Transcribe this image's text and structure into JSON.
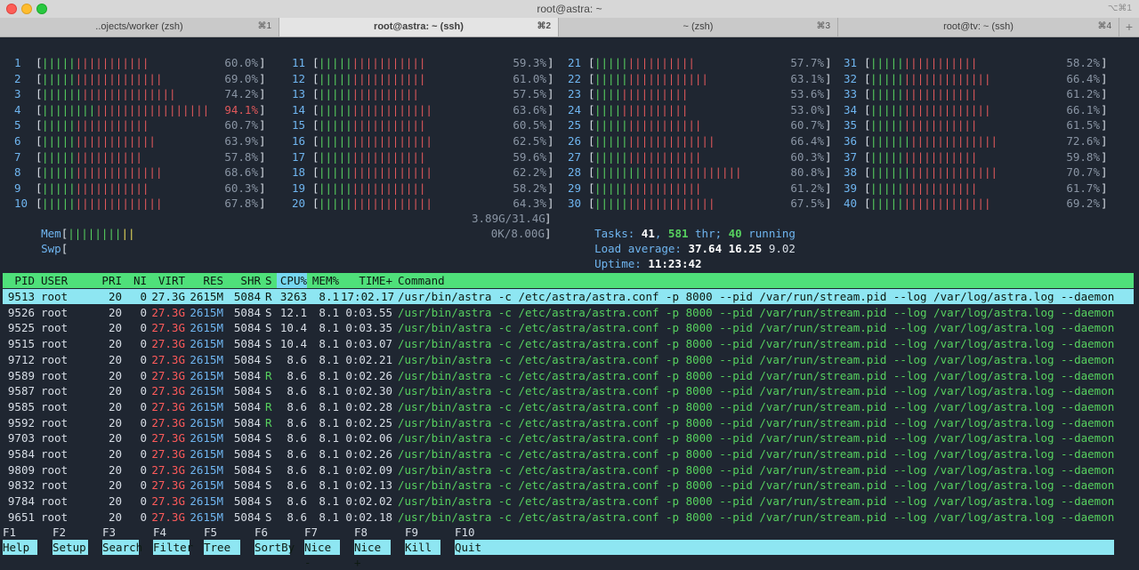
{
  "window": {
    "title": "root@astra: ~",
    "shortcut": "⌥⌘1",
    "tabs": [
      {
        "label": "..ojects/worker (zsh)",
        "key": "⌘1",
        "active": false
      },
      {
        "label": "root@astra: ~ (ssh)",
        "key": "⌘2",
        "active": true
      },
      {
        "label": "~ (zsh)",
        "key": "⌘3",
        "active": false
      },
      {
        "label": "root@tv: ~ (ssh)",
        "key": "⌘4",
        "active": false
      }
    ],
    "add_tab": "+"
  },
  "cpus": [
    {
      "n": "1",
      "pct": "60.0%",
      "value": 60.0
    },
    {
      "n": "2",
      "pct": "69.0%",
      "value": 69.0
    },
    {
      "n": "3",
      "pct": "74.2%",
      "value": 74.2
    },
    {
      "n": "4",
      "pct": "94.1%",
      "value": 94.1
    },
    {
      "n": "5",
      "pct": "60.7%",
      "value": 60.7
    },
    {
      "n": "6",
      "pct": "63.9%",
      "value": 63.9
    },
    {
      "n": "7",
      "pct": "57.8%",
      "value": 57.8
    },
    {
      "n": "8",
      "pct": "68.6%",
      "value": 68.6
    },
    {
      "n": "9",
      "pct": "60.3%",
      "value": 60.3
    },
    {
      "n": "10",
      "pct": "67.8%",
      "value": 67.8
    },
    {
      "n": "11",
      "pct": "59.3%",
      "value": 59.3
    },
    {
      "n": "12",
      "pct": "61.0%",
      "value": 61.0
    },
    {
      "n": "13",
      "pct": "57.5%",
      "value": 57.5
    },
    {
      "n": "14",
      "pct": "63.6%",
      "value": 63.6
    },
    {
      "n": "15",
      "pct": "60.5%",
      "value": 60.5
    },
    {
      "n": "16",
      "pct": "62.5%",
      "value": 62.5
    },
    {
      "n": "17",
      "pct": "59.6%",
      "value": 59.6
    },
    {
      "n": "18",
      "pct": "62.2%",
      "value": 62.2
    },
    {
      "n": "19",
      "pct": "58.2%",
      "value": 58.2
    },
    {
      "n": "20",
      "pct": "64.3%",
      "value": 64.3
    },
    {
      "n": "21",
      "pct": "57.7%",
      "value": 57.7
    },
    {
      "n": "22",
      "pct": "63.1%",
      "value": 63.1
    },
    {
      "n": "23",
      "pct": "53.6%",
      "value": 53.6
    },
    {
      "n": "24",
      "pct": "53.0%",
      "value": 53.0
    },
    {
      "n": "25",
      "pct": "60.7%",
      "value": 60.7
    },
    {
      "n": "26",
      "pct": "66.4%",
      "value": 66.4
    },
    {
      "n": "27",
      "pct": "60.3%",
      "value": 60.3
    },
    {
      "n": "28",
      "pct": "80.8%",
      "value": 80.8
    },
    {
      "n": "29",
      "pct": "61.2%",
      "value": 61.2
    },
    {
      "n": "30",
      "pct": "67.5%",
      "value": 67.5
    },
    {
      "n": "31",
      "pct": "58.2%",
      "value": 58.2
    },
    {
      "n": "32",
      "pct": "66.4%",
      "value": 66.4
    },
    {
      "n": "33",
      "pct": "61.2%",
      "value": 61.2
    },
    {
      "n": "34",
      "pct": "66.1%",
      "value": 66.1
    },
    {
      "n": "35",
      "pct": "61.5%",
      "value": 61.5
    },
    {
      "n": "36",
      "pct": "72.6%",
      "value": 72.6
    },
    {
      "n": "37",
      "pct": "59.8%",
      "value": 59.8
    },
    {
      "n": "38",
      "pct": "70.7%",
      "value": 70.7
    },
    {
      "n": "39",
      "pct": "61.7%",
      "value": 61.7
    },
    {
      "n": "40",
      "pct": "69.2%",
      "value": 69.2
    }
  ],
  "mem": {
    "label": "Mem",
    "value": "3.89G/31.4G",
    "fraction": 0.124
  },
  "swp": {
    "label": "Swp",
    "value": "0K/8.00G",
    "fraction": 0.0
  },
  "tasks": {
    "label": "Tasks: ",
    "count": "41",
    "sep": ", ",
    "threads": "581",
    "thr_label": " thr; ",
    "running": "40",
    "running_label": " running"
  },
  "load": {
    "label": "Load average: ",
    "v1": "37.64",
    "v2": "16.25",
    "v3": "9.02"
  },
  "uptime": {
    "label": "Uptime: ",
    "value": "11:23:42"
  },
  "table": {
    "headers": {
      "pid": "PID",
      "user": "USER",
      "pri": "PRI",
      "ni": "NI",
      "virt": "VIRT",
      "res": "RES",
      "shr": "SHR",
      "s": "S",
      "cpu": "CPU%",
      "mem": "MEM%",
      "time": "TIME+",
      "cmd": "Command"
    },
    "rows": [
      {
        "pid": "9513",
        "user": "root",
        "pri": "20",
        "ni": "0",
        "virt": "27.3G",
        "res": "2615M",
        "shr": "5084",
        "s": "R",
        "cpu": "3263",
        "mem": "8.1",
        "time": "17:02.17",
        "cmd": "/usr/bin/astra -c /etc/astra/astra.conf -p 8000 --pid /var/run/stream.pid --log /var/log/astra.log --daemon"
      },
      {
        "pid": "9526",
        "user": "root",
        "pri": "20",
        "ni": "0",
        "virt": "27.3G",
        "res": "2615M",
        "shr": "5084",
        "s": "S",
        "cpu": "12.1",
        "mem": "8.1",
        "time": "0:03.55",
        "cmd": "/usr/bin/astra -c /etc/astra/astra.conf -p 8000 --pid /var/run/stream.pid --log /var/log/astra.log --daemon"
      },
      {
        "pid": "9525",
        "user": "root",
        "pri": "20",
        "ni": "0",
        "virt": "27.3G",
        "res": "2615M",
        "shr": "5084",
        "s": "S",
        "cpu": "10.4",
        "mem": "8.1",
        "time": "0:03.35",
        "cmd": "/usr/bin/astra -c /etc/astra/astra.conf -p 8000 --pid /var/run/stream.pid --log /var/log/astra.log --daemon"
      },
      {
        "pid": "9515",
        "user": "root",
        "pri": "20",
        "ni": "0",
        "virt": "27.3G",
        "res": "2615M",
        "shr": "5084",
        "s": "S",
        "cpu": "10.4",
        "mem": "8.1",
        "time": "0:03.07",
        "cmd": "/usr/bin/astra -c /etc/astra/astra.conf -p 8000 --pid /var/run/stream.pid --log /var/log/astra.log --daemon"
      },
      {
        "pid": "9712",
        "user": "root",
        "pri": "20",
        "ni": "0",
        "virt": "27.3G",
        "res": "2615M",
        "shr": "5084",
        "s": "S",
        "cpu": "8.6",
        "mem": "8.1",
        "time": "0:02.21",
        "cmd": "/usr/bin/astra -c /etc/astra/astra.conf -p 8000 --pid /var/run/stream.pid --log /var/log/astra.log --daemon"
      },
      {
        "pid": "9589",
        "user": "root",
        "pri": "20",
        "ni": "0",
        "virt": "27.3G",
        "res": "2615M",
        "shr": "5084",
        "s": "R",
        "cpu": "8.6",
        "mem": "8.1",
        "time": "0:02.26",
        "cmd": "/usr/bin/astra -c /etc/astra/astra.conf -p 8000 --pid /var/run/stream.pid --log /var/log/astra.log --daemon"
      },
      {
        "pid": "9587",
        "user": "root",
        "pri": "20",
        "ni": "0",
        "virt": "27.3G",
        "res": "2615M",
        "shr": "5084",
        "s": "S",
        "cpu": "8.6",
        "mem": "8.1",
        "time": "0:02.30",
        "cmd": "/usr/bin/astra -c /etc/astra/astra.conf -p 8000 --pid /var/run/stream.pid --log /var/log/astra.log --daemon"
      },
      {
        "pid": "9585",
        "user": "root",
        "pri": "20",
        "ni": "0",
        "virt": "27.3G",
        "res": "2615M",
        "shr": "5084",
        "s": "R",
        "cpu": "8.6",
        "mem": "8.1",
        "time": "0:02.28",
        "cmd": "/usr/bin/astra -c /etc/astra/astra.conf -p 8000 --pid /var/run/stream.pid --log /var/log/astra.log --daemon"
      },
      {
        "pid": "9592",
        "user": "root",
        "pri": "20",
        "ni": "0",
        "virt": "27.3G",
        "res": "2615M",
        "shr": "5084",
        "s": "R",
        "cpu": "8.6",
        "mem": "8.1",
        "time": "0:02.25",
        "cmd": "/usr/bin/astra -c /etc/astra/astra.conf -p 8000 --pid /var/run/stream.pid --log /var/log/astra.log --daemon"
      },
      {
        "pid": "9703",
        "user": "root",
        "pri": "20",
        "ni": "0",
        "virt": "27.3G",
        "res": "2615M",
        "shr": "5084",
        "s": "S",
        "cpu": "8.6",
        "mem": "8.1",
        "time": "0:02.06",
        "cmd": "/usr/bin/astra -c /etc/astra/astra.conf -p 8000 --pid /var/run/stream.pid --log /var/log/astra.log --daemon"
      },
      {
        "pid": "9584",
        "user": "root",
        "pri": "20",
        "ni": "0",
        "virt": "27.3G",
        "res": "2615M",
        "shr": "5084",
        "s": "S",
        "cpu": "8.6",
        "mem": "8.1",
        "time": "0:02.26",
        "cmd": "/usr/bin/astra -c /etc/astra/astra.conf -p 8000 --pid /var/run/stream.pid --log /var/log/astra.log --daemon"
      },
      {
        "pid": "9809",
        "user": "root",
        "pri": "20",
        "ni": "0",
        "virt": "27.3G",
        "res": "2615M",
        "shr": "5084",
        "s": "S",
        "cpu": "8.6",
        "mem": "8.1",
        "time": "0:02.09",
        "cmd": "/usr/bin/astra -c /etc/astra/astra.conf -p 8000 --pid /var/run/stream.pid --log /var/log/astra.log --daemon"
      },
      {
        "pid": "9832",
        "user": "root",
        "pri": "20",
        "ni": "0",
        "virt": "27.3G",
        "res": "2615M",
        "shr": "5084",
        "s": "S",
        "cpu": "8.6",
        "mem": "8.1",
        "time": "0:02.13",
        "cmd": "/usr/bin/astra -c /etc/astra/astra.conf -p 8000 --pid /var/run/stream.pid --log /var/log/astra.log --daemon"
      },
      {
        "pid": "9784",
        "user": "root",
        "pri": "20",
        "ni": "0",
        "virt": "27.3G",
        "res": "2615M",
        "shr": "5084",
        "s": "S",
        "cpu": "8.6",
        "mem": "8.1",
        "time": "0:02.02",
        "cmd": "/usr/bin/astra -c /etc/astra/astra.conf -p 8000 --pid /var/run/stream.pid --log /var/log/astra.log --daemon"
      },
      {
        "pid": "9651",
        "user": "root",
        "pri": "20",
        "ni": "0",
        "virt": "27.3G",
        "res": "2615M",
        "shr": "5084",
        "s": "S",
        "cpu": "8.6",
        "mem": "8.1",
        "time": "0:02.18",
        "cmd": "/usr/bin/astra -c /etc/astra/astra.conf -p 8000 --pid /var/run/stream.pid --log /var/log/astra.log --daemon"
      }
    ]
  },
  "fkeys": [
    {
      "key": "F1",
      "label": "Help"
    },
    {
      "key": "F2",
      "label": "Setup"
    },
    {
      "key": "F3",
      "label": "Search"
    },
    {
      "key": "F4",
      "label": "Filter"
    },
    {
      "key": "F5",
      "label": "Tree"
    },
    {
      "key": "F6",
      "label": "SortBy"
    },
    {
      "key": "F7",
      "label": "Nice -"
    },
    {
      "key": "F8",
      "label": "Nice +"
    },
    {
      "key": "F9",
      "label": "Kill"
    },
    {
      "key": "F10",
      "label": "Quit"
    }
  ],
  "colors": {
    "accent_green": "#4fe07a",
    "accent_cyan": "#8ee6f2",
    "bar_low": "#57d15f",
    "bar_high": "#e0585b",
    "background": "#1f2631"
  },
  "icons": {
    "close": "close-traffic-light",
    "minimize": "minimize-traffic-light",
    "maximize": "maximize-traffic-light"
  }
}
